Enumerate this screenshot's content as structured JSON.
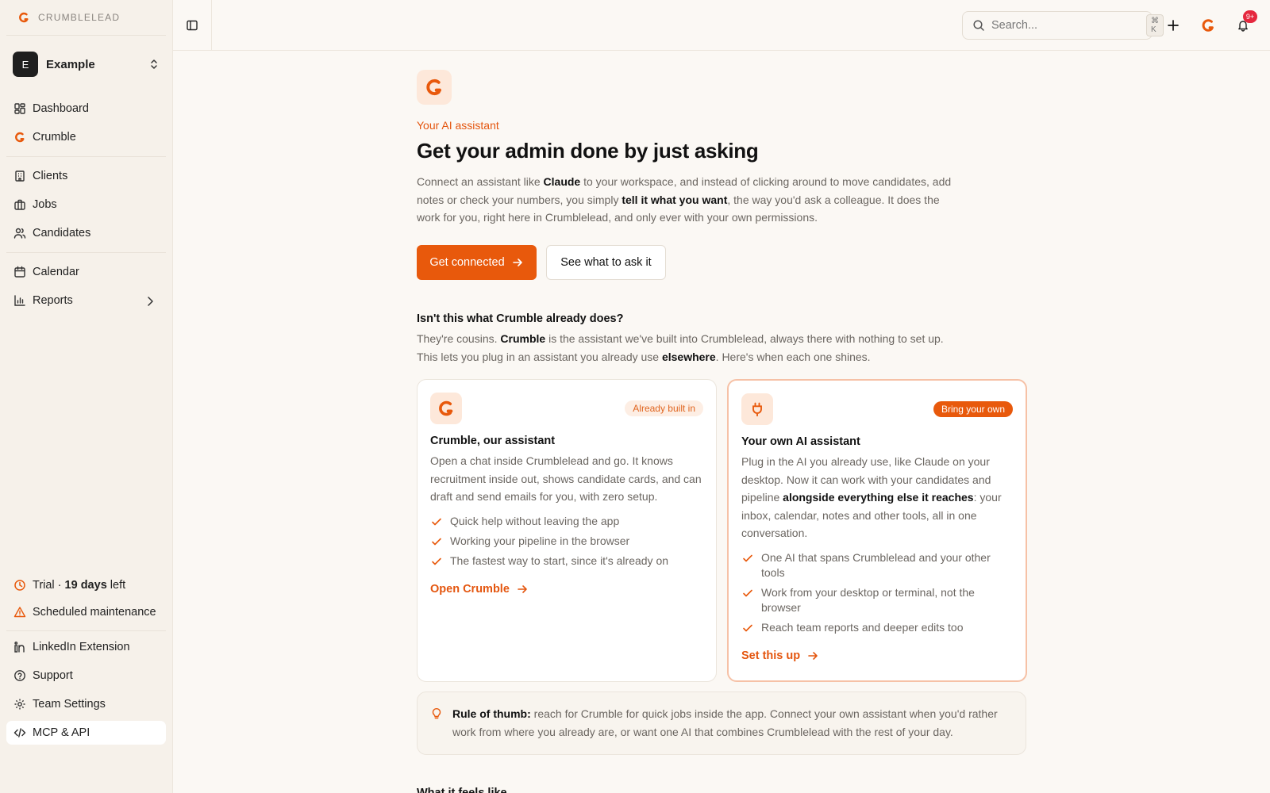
{
  "colors": {
    "accent": "#e8590c",
    "accent_soft": "#fde8da",
    "badge": "#e5283e"
  },
  "brand": {
    "name": "CRUMBLELEAD",
    "logo_icon": "crumble-logo-icon"
  },
  "workspace": {
    "initial": "E",
    "name": "Example"
  },
  "sidebar": {
    "nav": [
      {
        "label": "Dashboard",
        "icon": "dashboard-icon"
      },
      {
        "label": "Crumble",
        "icon": "crumble-logo-icon"
      },
      {
        "label": "Clients",
        "icon": "building-icon"
      },
      {
        "label": "Jobs",
        "icon": "briefcase-icon"
      },
      {
        "label": "Candidates",
        "icon": "users-icon"
      },
      {
        "label": "Calendar",
        "icon": "calendar-icon"
      },
      {
        "label": "Reports",
        "icon": "bar-chart-icon"
      }
    ],
    "trial": {
      "prefix": "Trial · ",
      "days": "19 days",
      "suffix": " left"
    },
    "maintenance": "Scheduled maintenance",
    "bottom": [
      {
        "label": "LinkedIn Extension",
        "icon": "linkedin-icon"
      },
      {
        "label": "Support",
        "icon": "help-circle-icon"
      },
      {
        "label": "Team Settings",
        "icon": "gear-icon"
      },
      {
        "label": "MCP & API",
        "icon": "code-icon"
      }
    ]
  },
  "topbar": {
    "search_placeholder": "Search...",
    "shortcut": "⌘ K",
    "notifications_badge": "9+"
  },
  "hero": {
    "eyebrow": "Your AI assistant",
    "title": "Get your admin done by just asking",
    "lead_1": "Connect an assistant like ",
    "lead_b1": "Claude",
    "lead_2": " to your workspace, and instead of clicking around to move candidates, add notes or check your numbers, you simply ",
    "lead_b2": "tell it what you want",
    "lead_3": ", the way you'd ask a colleague. It does the work for you, right here in Crumblelead, and only ever with your own permissions.",
    "primary_cta": "Get connected",
    "secondary_cta": "See what to ask it"
  },
  "compare": {
    "question": "Isn't this what Crumble already does?",
    "sub_1": "They're cousins. ",
    "sub_b1": "Crumble",
    "sub_2": " is the assistant we've built into Crumblelead, always there with nothing to set up. This lets you plug in an assistant you already use ",
    "sub_b2": "elsewhere",
    "sub_3": ". Here's when each one shines."
  },
  "cards": [
    {
      "tag": "Already built in",
      "title": "Crumble, our assistant",
      "body": "Open a chat inside Crumblelead and go. It knows recruitment inside out, shows candidate cards, and can draft and send emails for you, with zero setup.",
      "checks": [
        "Quick help without leaving the app",
        "Working your pipeline in the browser",
        "The fastest way to start, since it's already on"
      ],
      "link": "Open Crumble"
    },
    {
      "tag": "Bring your own",
      "title": "Your own AI assistant",
      "body_1": "Plug in the AI you already use, like Claude on your desktop. Now it can work with your candidates and pipeline ",
      "body_b": "alongside everything else it reaches",
      "body_2": ": your inbox, calendar, notes and other tools, all in one conversation.",
      "checks": [
        "One AI that spans Crumblelead and your other tools",
        "Work from your desktop or terminal, not the browser",
        "Reach team reports and deeper edits too"
      ],
      "link": "Set this up"
    }
  ],
  "tip": {
    "label": "Rule of thumb:",
    "text": " reach for Crumble for quick jobs inside the app. Connect your own assistant when you'd rather work from where you already are, or want one AI that combines Crumblelead with the rest of your day."
  },
  "next_section_title": "What it feels like"
}
